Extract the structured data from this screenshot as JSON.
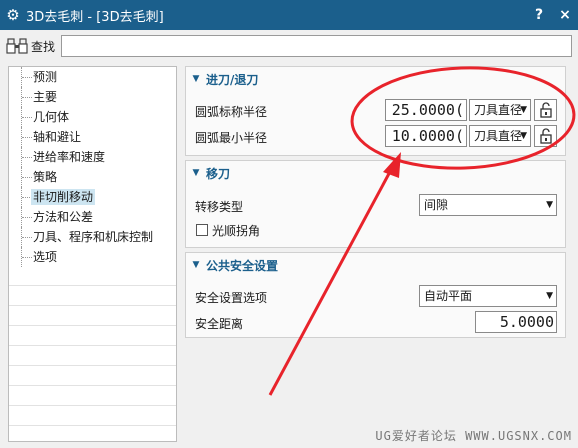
{
  "window": {
    "title": "3D去毛刺 - [3D去毛刺]",
    "help_label": "?",
    "close_label": "×"
  },
  "find": {
    "label": "查找",
    "value": ""
  },
  "tree": {
    "items": [
      {
        "label": "预测",
        "selected": false
      },
      {
        "label": "主要",
        "selected": false
      },
      {
        "label": "几何体",
        "selected": false
      },
      {
        "label": "轴和避让",
        "selected": false
      },
      {
        "label": "进给率和速度",
        "selected": false
      },
      {
        "label": "策略",
        "selected": false
      },
      {
        "label": "非切削移动",
        "selected": true
      },
      {
        "label": "方法和公差",
        "selected": false
      },
      {
        "label": "刀具、程序和机床控制",
        "selected": false
      },
      {
        "label": "选项",
        "selected": false
      }
    ]
  },
  "sections": {
    "engage": {
      "title": "进刀/退刀",
      "nominal_radius": {
        "label": "圆弧标称半径",
        "value": "25.0000(",
        "unit": "刀具直径"
      },
      "min_radius": {
        "label": "圆弧最小半径",
        "value": "10.0000(",
        "unit": "刀具直径"
      }
    },
    "transfer": {
      "title": "移刀",
      "type": {
        "label": "转移类型",
        "value": "间隙"
      },
      "smooth_corner": {
        "label": "光顺拐角",
        "checked": false
      }
    },
    "safety": {
      "title": "公共安全设置",
      "option": {
        "label": "安全设置选项",
        "value": "自动平面"
      },
      "distance": {
        "label": "安全距离",
        "value": "5.0000"
      }
    }
  },
  "colors": {
    "titlebar": "#1b5f8c",
    "annotation": "#e8232b",
    "selection": "#cde5f1"
  },
  "icons": {
    "app": "gear-icon",
    "find": "binoculars-icon",
    "lock": "unlock-icon",
    "dropdown": "chevron-down-icon",
    "collapse": "collapse-triangle-icon"
  },
  "watermark": "UG爱好者论坛 WWW.UGSNX.COM"
}
